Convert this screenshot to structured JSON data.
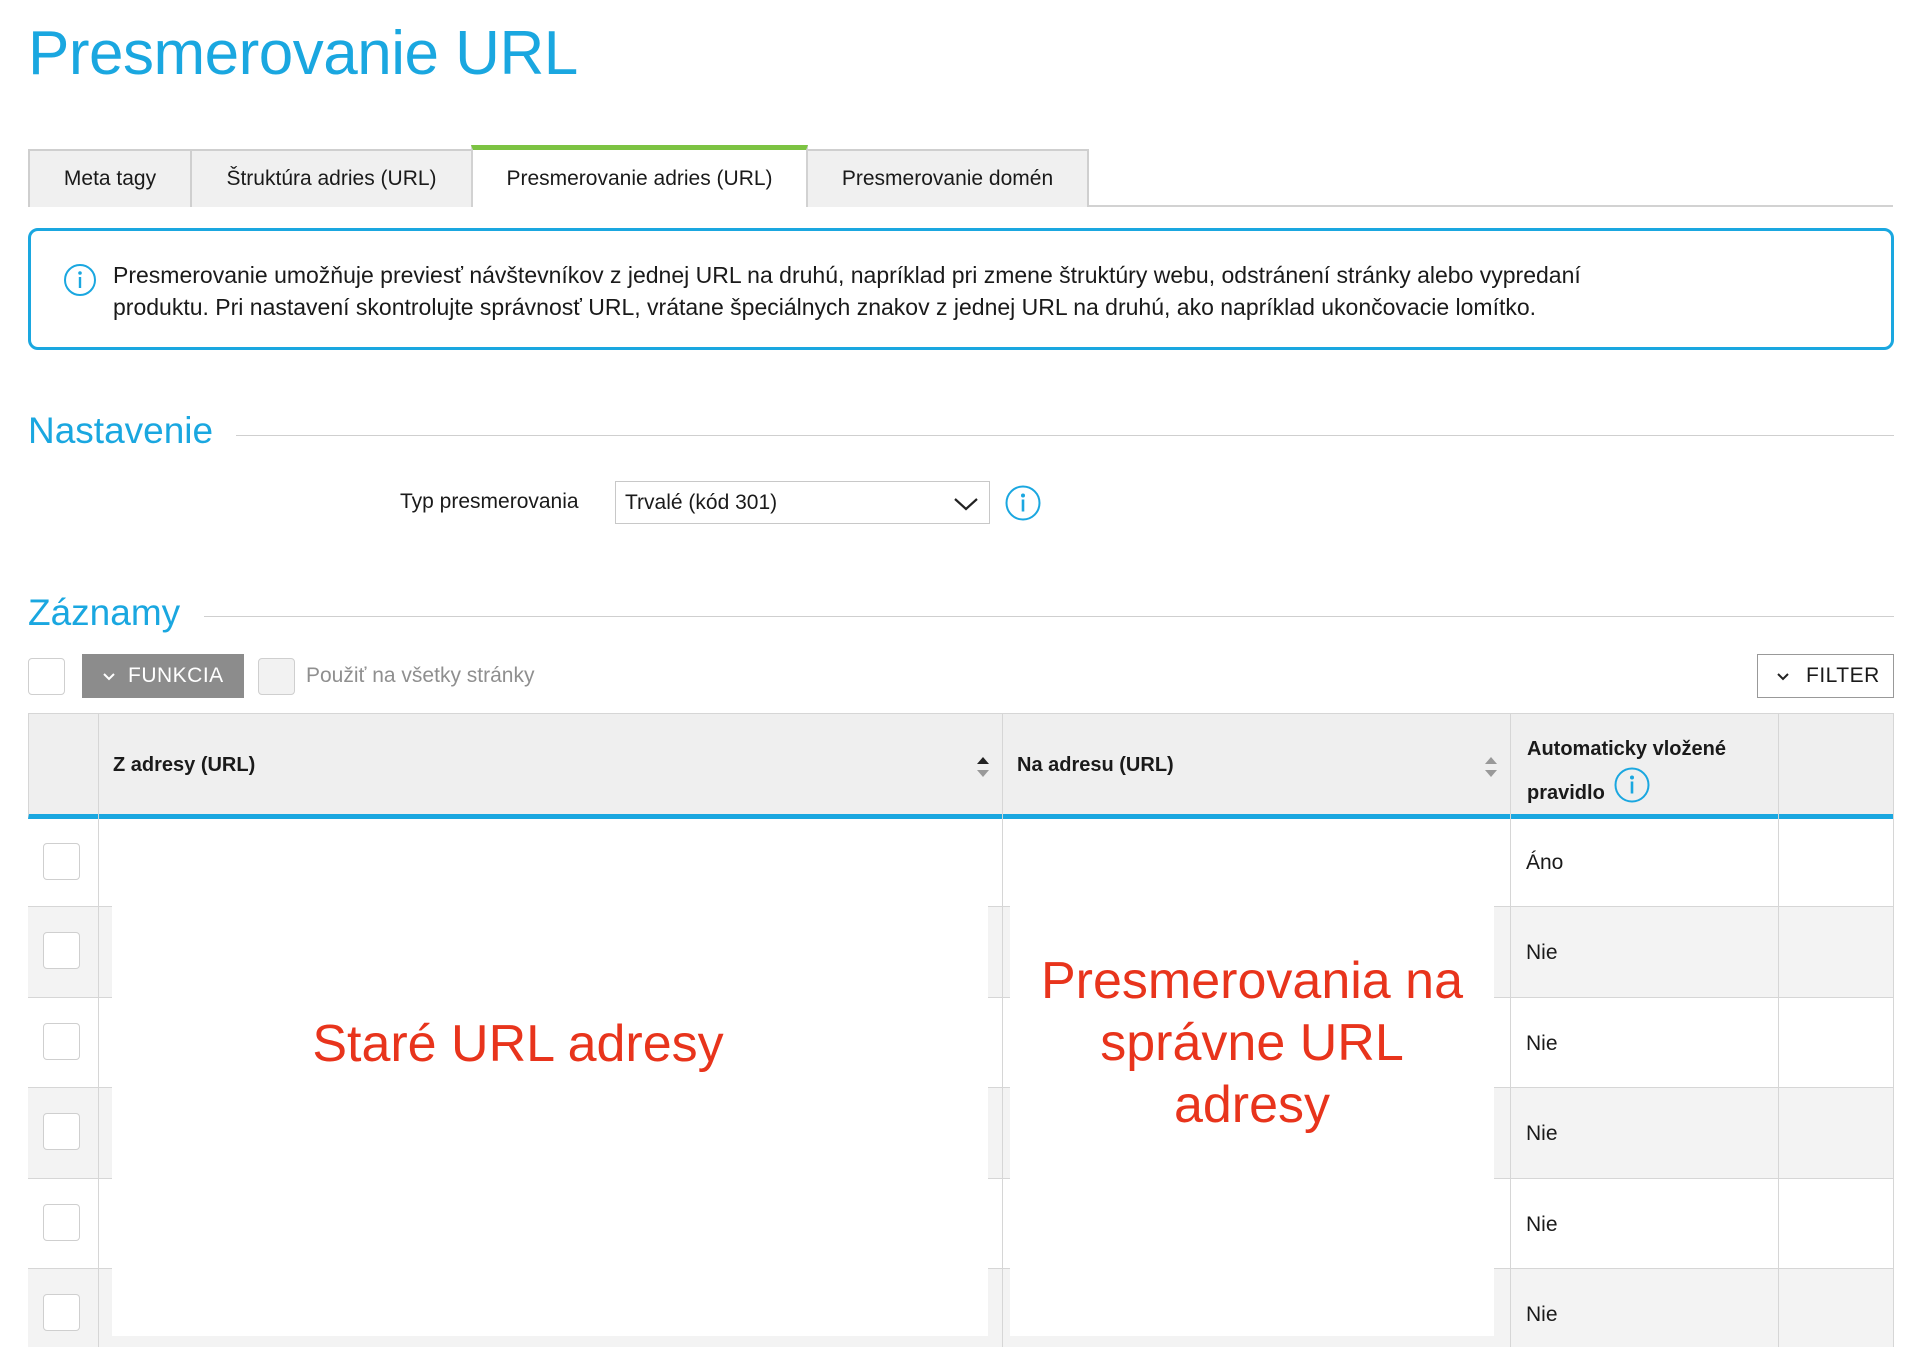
{
  "page": {
    "title": "Presmerovanie URL"
  },
  "tabs": [
    {
      "label": "Meta tagy",
      "active": false
    },
    {
      "label": "Štruktúra adries (URL)",
      "active": false
    },
    {
      "label": "Presmerovanie adries (URL)",
      "active": true
    },
    {
      "label": "Presmerovanie domén",
      "active": false
    }
  ],
  "info": {
    "line1": "Presmerovanie umožňuje previesť návštevníkov z jednej URL na druhú, napríklad pri zmene štruktúry webu, odstránení stránky alebo vypredaní",
    "line2": "produktu. Pri nastavení skontrolujte správnosť URL, vrátane špeciálnych znakov z jednej URL na druhú, ako napríklad ukončovacie lomítko."
  },
  "settings": {
    "title": "Nastavenie",
    "redirect_type_label": "Typ presmerovania",
    "redirect_type_value": "Trvalé (kód 301)"
  },
  "records": {
    "title": "Záznamy",
    "function_button": "FUNKCIA",
    "apply_all_label": "Použiť na všetky stránky",
    "filter_button": "FILTER",
    "columns": {
      "from": "Z adresy (URL)",
      "to": "Na adresu (URL)",
      "auto": "Automaticky vložené pravidlo"
    },
    "rows": [
      {
        "auto": "Áno"
      },
      {
        "auto": "Nie"
      },
      {
        "auto": "Nie"
      },
      {
        "auto": "Nie"
      },
      {
        "auto": "Nie"
      },
      {
        "auto": "Nie"
      }
    ]
  },
  "annotations": {
    "old_urls": "Staré URL adresy",
    "new_urls_line1": "Presmerovania na",
    "new_urls_line2": "správne URL",
    "new_urls_line3": "adresy"
  },
  "colors": {
    "accent": "#1aa7e0",
    "active_tab": "#7cc342",
    "annotation": "#e8341c",
    "function_button": "#8c8c8c"
  },
  "icons": {
    "info": "info-circle-icon",
    "dropdown": "chevron-down-icon",
    "sort": "sort-arrows-icon"
  }
}
